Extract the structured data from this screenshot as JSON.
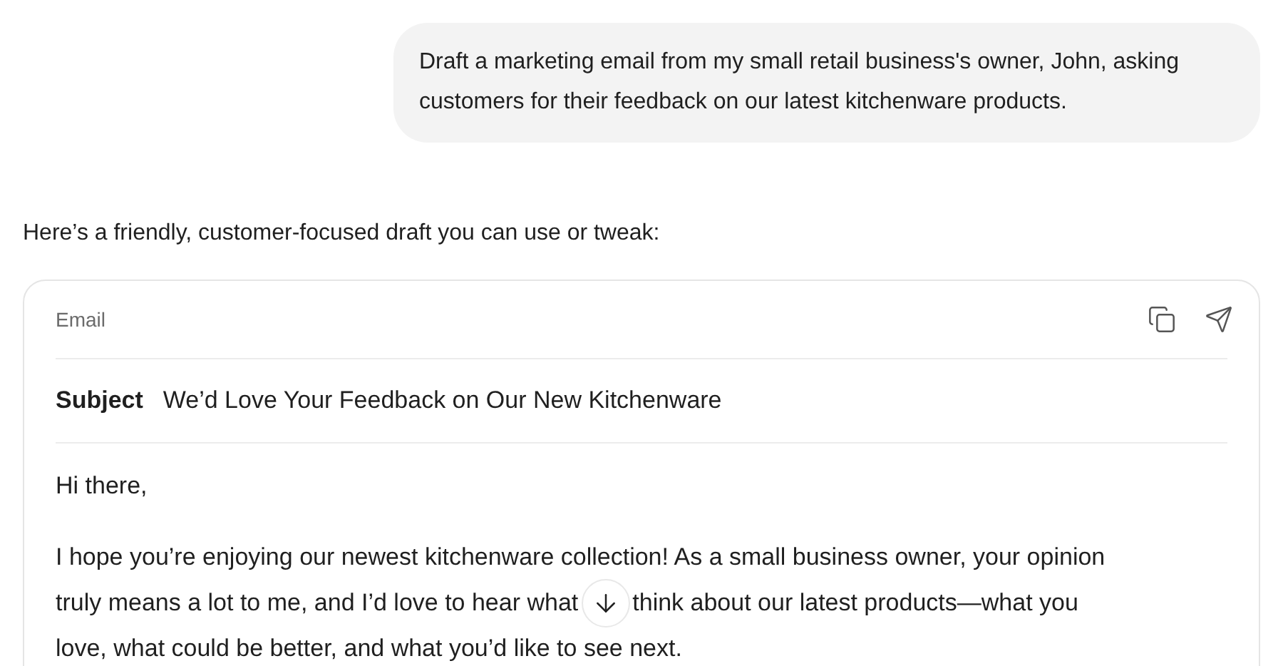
{
  "user_message": {
    "text": "Draft a marketing email from my small retail business's owner, John, asking customers for their feedback on our latest kitchenware products."
  },
  "assistant_intro": "Here’s a friendly, customer-focused draft you can use or tweak:",
  "email_card": {
    "label": "Email",
    "subject_label": "Subject",
    "subject": "We’d Love Your Feedback on Our New Kitchenware",
    "greeting": "Hi there,",
    "body_lines": [
      {
        "text": "I hope you’re enjoying our newest kitchenware collection! As a small business owner, your opinion"
      },
      {
        "text": "truly means a lot to me, and I’d love to hear what",
        "after_scroll_button": "think about our latest products—what you"
      },
      {
        "text": "love, what could be better, and what you’d like to see next."
      }
    ]
  }
}
